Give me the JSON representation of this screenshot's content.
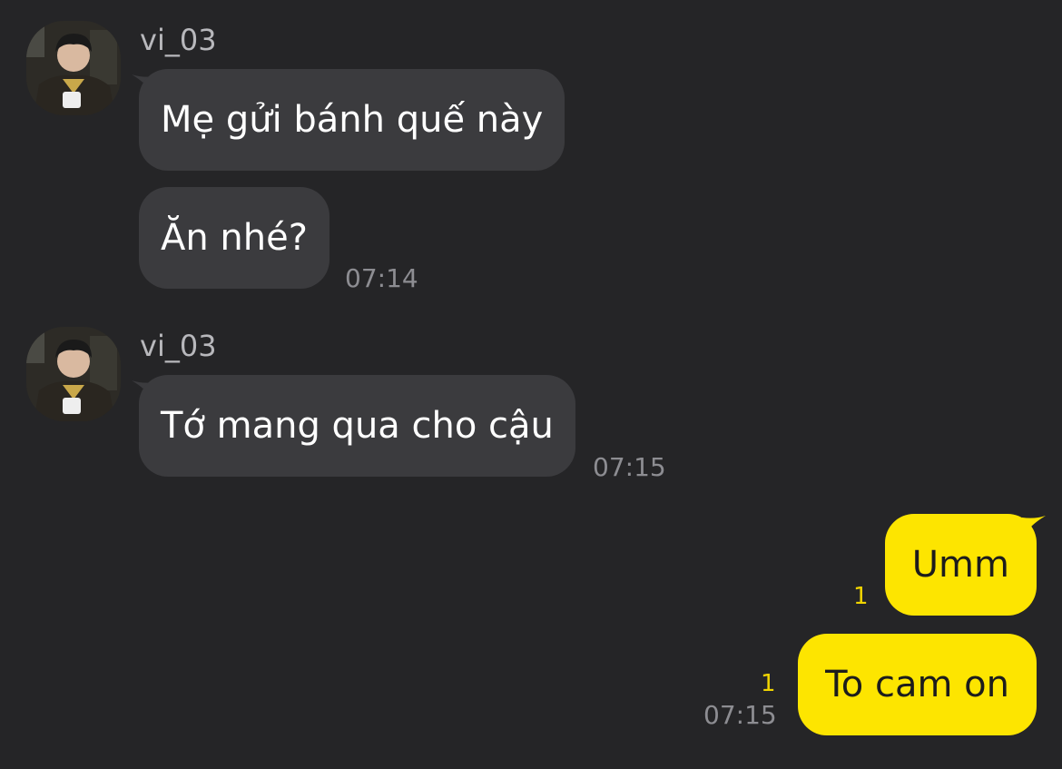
{
  "chat": {
    "groups": [
      {
        "sender": "vi_03",
        "messages": [
          "Mẹ gửi bánh quế này",
          "Ăn nhé?"
        ],
        "time": "07:14"
      },
      {
        "sender": "vi_03",
        "messages": [
          "Tớ mang qua cho cậu"
        ],
        "time": "07:15"
      }
    ],
    "outgoing": {
      "messages": [
        {
          "text": "Umm",
          "unread": "1"
        },
        {
          "text": "To cam on",
          "unread": "1"
        }
      ],
      "time": "07:15"
    }
  },
  "colors": {
    "background": "#252527",
    "incoming_bubble": "#3b3b3e",
    "outgoing_bubble": "#fde500",
    "unread_count": "#f0d400"
  }
}
